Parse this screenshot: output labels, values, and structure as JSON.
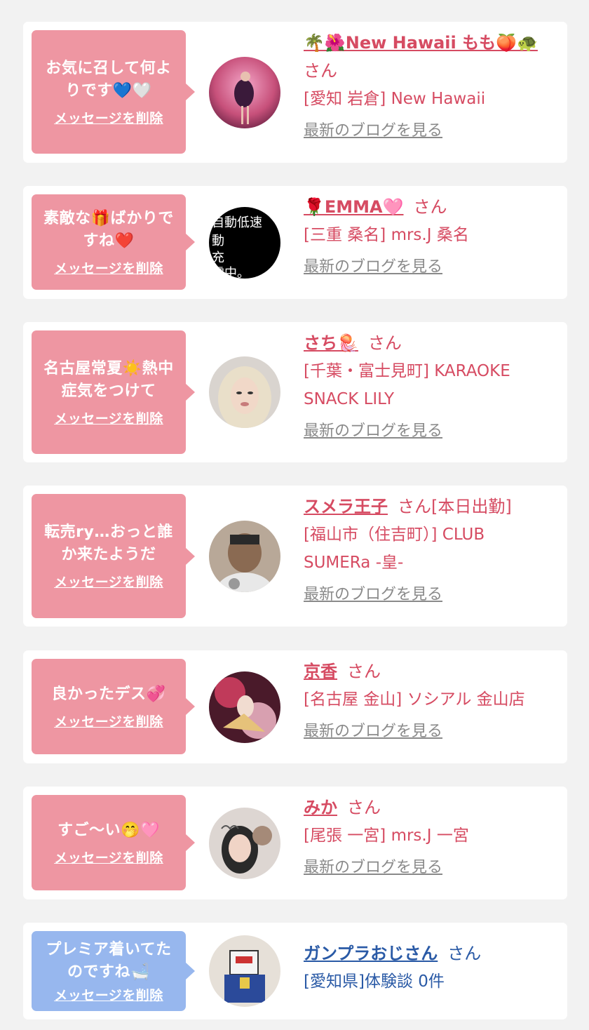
{
  "delete_label": "メッセージを削除",
  "blog_label": "最新のブログを見る",
  "san_label": "さん",
  "colors": {
    "pink_bubble": "#ee96a2",
    "blue_bubble": "#97b7ee",
    "name_pink": "#d64b62",
    "name_blue": "#2a5aa6"
  },
  "cards": [
    {
      "message_line1": "お気に召して何よ",
      "message_line2": "りです💙🤍",
      "name": "🌴🌺New Hawaii もも🍑🐢",
      "suffix": "",
      "shop_line1": "[愛知 岩倉] New Hawaii",
      "shop_line2": ""
    },
    {
      "message_line1": "素敵な🎁ばかりで",
      "message_line2": "すね❤️",
      "name": "🌹EMMA🩷",
      "suffix": "",
      "shop_line1": "[三重 桑名] mrs.J 桑名",
      "shop_line2": ""
    },
    {
      "message_line1": "名古屋常夏☀️熱中",
      "message_line2": "症気をつけて",
      "name": "さち🪼",
      "suffix": "",
      "shop_line1": "[千葉・富士見町] KARAOKE",
      "shop_line2": "SNACK LILY"
    },
    {
      "message_line1": "転売ry…おっと誰",
      "message_line2": "か来たようだ",
      "name": "スメラ王子",
      "suffix": "[本日出勤]",
      "shop_line1": "[福山市（住吉町）] CLUB",
      "shop_line2": "SUMERa -皇-"
    },
    {
      "message_line1": "良かったデス💞",
      "message_line2": "",
      "name": "京香",
      "suffix": "",
      "shop_line1": "[名古屋 金山] ソシアル 金山店",
      "shop_line2": ""
    },
    {
      "message_line1": "すご〜い🤭🩷",
      "message_line2": "",
      "name": "みか",
      "suffix": "",
      "shop_line1": "[尾張 一宮] mrs.J 一宮",
      "shop_line2": ""
    },
    {
      "message_line1": "プレミア着いてた",
      "message_line2": "のですね🛁",
      "name": "ガンプラおじさん",
      "suffix": "",
      "shop_line1": "[愛知県]体験談 0件",
      "shop_line2": ""
    }
  ]
}
